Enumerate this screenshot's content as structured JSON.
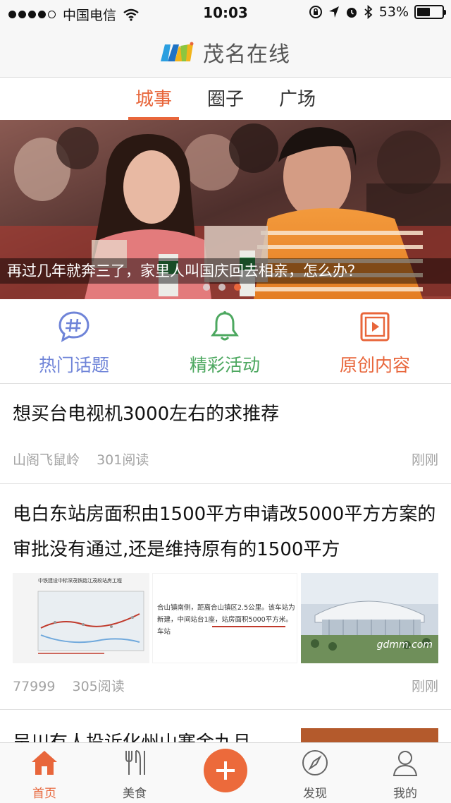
{
  "status_bar": {
    "carrier": "中国电信",
    "time": "10:03",
    "battery": "53%",
    "battery_level": 0.53
  },
  "header": {
    "title": "茂名在线"
  },
  "tabs": [
    {
      "label": "城事",
      "active": true
    },
    {
      "label": "圈子",
      "active": false
    },
    {
      "label": "广场",
      "active": false
    }
  ],
  "banner": {
    "caption": "再过几年就奔三了，家里人叫国庆回去相亲，怎么办？",
    "slide_count": 3,
    "active_slide": 3
  },
  "quick_links": [
    {
      "label": "热门话题",
      "icon": "chat-hash-icon",
      "color": "#6f84d8"
    },
    {
      "label": "精彩活动",
      "icon": "bell-icon",
      "color": "#4da860"
    },
    {
      "label": "原创内容",
      "icon": "video-play-icon",
      "color": "#e8663b"
    }
  ],
  "feed": [
    {
      "title": "想买台电视机3000左右的求推荐",
      "author": "山阁飞鼠岭",
      "reads": "301阅读",
      "time": "刚刚"
    },
    {
      "title": "电白东站房面积由1500平方申请改5000平方方案的审批没有通过,还是维持原有的1500平方",
      "author": "77999",
      "reads": "305阅读",
      "time": "刚刚",
      "images": {
        "doc_heading": "中铁建设中标深茂铁路江茂段站房工程",
        "clipping_text": "合山镇南侧，距离合山镇区2.5公里。该车站为新建，中间站台1座，站房面积5000平方米。车站",
        "watermark": "gdmm.com"
      }
    },
    {
      "title": "吴川有人投诉化州山寨金九月"
    }
  ],
  "tabbar": [
    {
      "label": "首页",
      "icon": "home-icon",
      "active": true
    },
    {
      "label": "美食",
      "icon": "fork-knife-icon",
      "active": false
    },
    {
      "label": "",
      "icon": "plus-icon",
      "active": false
    },
    {
      "label": "发现",
      "icon": "compass-icon",
      "active": false
    },
    {
      "label": "我的",
      "icon": "user-icon",
      "active": false
    }
  ],
  "colors": {
    "accent": "#e8663b",
    "blue": "#6f84d8",
    "green": "#4da860",
    "meta_gray": "#a3a3a3"
  }
}
